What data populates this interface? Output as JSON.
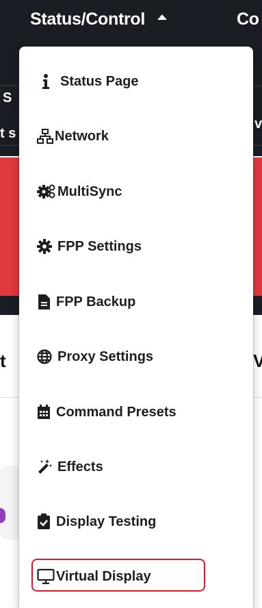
{
  "navbar": {
    "status_label": "Status/Control",
    "next_label": "Co"
  },
  "background": {
    "fragment1": "S",
    "fragment2": "t s",
    "fragment3": "v",
    "fragment4": "t",
    "fragment5": "V"
  },
  "menu": {
    "items": [
      {
        "label": "Status Page",
        "icon": "info-icon"
      },
      {
        "label": "Network",
        "icon": "network-icon"
      },
      {
        "label": "MultiSync",
        "icon": "cogs-icon"
      },
      {
        "label": "FPP Settings",
        "icon": "gear-icon"
      },
      {
        "label": "FPP Backup",
        "icon": "file-icon"
      },
      {
        "label": "Proxy Settings",
        "icon": "globe-icon"
      },
      {
        "label": "Command Presets",
        "icon": "calendar-icon"
      },
      {
        "label": "Effects",
        "icon": "magic-wand-icon"
      },
      {
        "label": "Display Testing",
        "icon": "clipboard-check-icon"
      },
      {
        "label": "Virtual Display",
        "icon": "monitor-icon"
      }
    ],
    "highlighted_item": "Virtual Display",
    "highlight_color": "#e0162b"
  }
}
